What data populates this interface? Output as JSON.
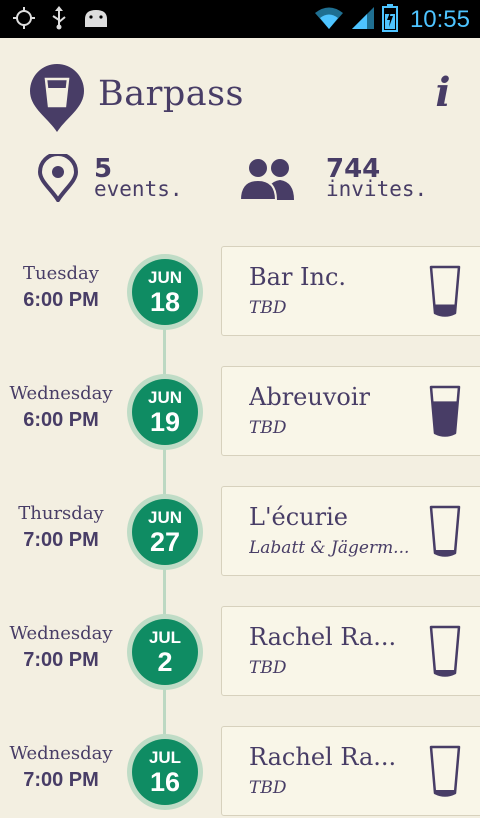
{
  "status_bar": {
    "time": "10:55",
    "icons": [
      "gps-icon",
      "usb-icon",
      "android-icon",
      "wifi-icon",
      "signal-icon",
      "battery-charging-icon"
    ]
  },
  "header": {
    "app_name": "Barpass",
    "info_label": "i"
  },
  "stats": {
    "events_count": "5",
    "events_label": "events.",
    "invites_count": "744",
    "invites_label": "invites."
  },
  "events": [
    {
      "day": "Tuesday",
      "time": "6:00 PM",
      "month": "JUN",
      "date": "18",
      "name": "Bar Inc.",
      "sponsor": "TBD",
      "fill_level": 0.25
    },
    {
      "day": "Wednesday",
      "time": "6:00 PM",
      "month": "JUN",
      "date": "19",
      "name": "Abreuvoir",
      "sponsor": "TBD",
      "fill_level": 0.8
    },
    {
      "day": "Thursday",
      "time": "7:00 PM",
      "month": "JUN",
      "date": "27",
      "name": "L'écurie",
      "sponsor": "Labatt & Jägerm...",
      "fill_level": 0.12
    },
    {
      "day": "Wednesday",
      "time": "7:00 PM",
      "month": "JUL",
      "date": "2",
      "name": "Rachel Ra...",
      "sponsor": "TBD",
      "fill_level": 0.12
    },
    {
      "day": "Wednesday",
      "time": "7:00 PM",
      "month": "JUL",
      "date": "16",
      "name": "Rachel Ra...",
      "sponsor": "TBD",
      "fill_level": 0.12
    }
  ],
  "colors": {
    "background": "#f3efe1",
    "primary_purple": "#483d66",
    "badge_green": "#0f8c63",
    "badge_ring": "#bfdcc6",
    "card_bg": "#f9f6e8",
    "clock_blue": "#4ec4ff"
  }
}
